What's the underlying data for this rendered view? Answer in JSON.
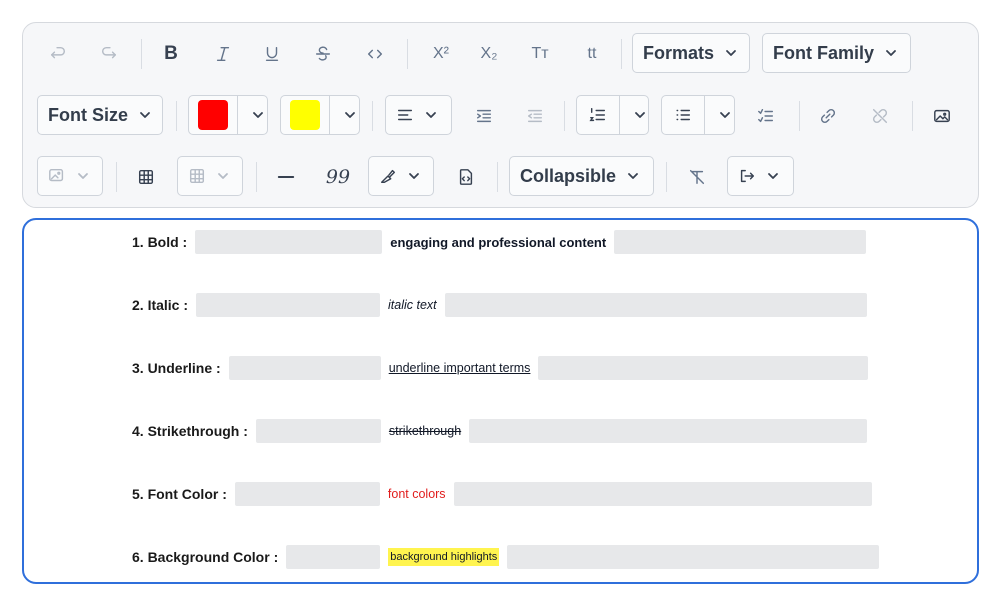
{
  "toolbar": {
    "formats_label": "Formats",
    "font_family_label": "Font Family",
    "font_size_label": "Font Size",
    "collapsible_label": "Collapsible",
    "superscript_glyph": "X²",
    "subscript_glyph": "X₂",
    "uppercase_glyph": "Tт",
    "lowercase_glyph": "tt",
    "font_color_value": "#ff0000",
    "highlight_color_value": "#ffff00",
    "quote_glyph": "99"
  },
  "editor": {
    "lines": [
      {
        "label": "1. Bold :",
        "sample": "engaging and professional content"
      },
      {
        "label": "2. Italic :",
        "sample": "italic text"
      },
      {
        "label": "3. Underline :",
        "sample": "underline important terms"
      },
      {
        "label": "4. Strikethrough :",
        "sample": "strikethrough"
      },
      {
        "label": "5. Font Color :",
        "sample": "font colors"
      },
      {
        "label": "6. Background Color :",
        "sample": "background highlights"
      }
    ]
  },
  "colors": {
    "accent_border": "#2f6fdb",
    "font_color_text": "#e11d1d",
    "highlight_bg": "#fff44f"
  }
}
